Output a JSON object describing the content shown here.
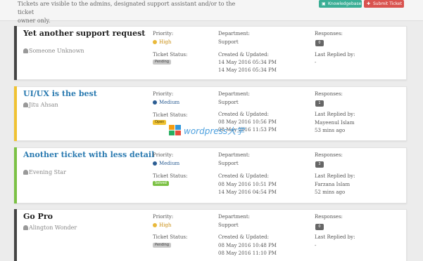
{
  "header": {
    "notice_line1": "Tickets are visible to the admins, designated support assistant and/or to the ticket",
    "notice_line2": "owner only.",
    "knowledgebase_label": "Knowledgebase",
    "submit_label": "Submit Ticket",
    "knowledgebase_icon": "book-icon",
    "submit_icon": "plus-icon"
  },
  "labels": {
    "priority": "Priority:",
    "ticket_status": "Ticket Status:",
    "department": "Department:",
    "created_updated": "Created & Updated:",
    "responses": "Responses:",
    "last_replied": "Last Replied by:"
  },
  "tickets": [
    {
      "title": "Yet another support request",
      "author": "Someone Unknown",
      "priority": "High",
      "status": "Pending",
      "department": "Support",
      "created": "14 May 2016 05:34 PM",
      "updated": "14 May 2016 05:34 PM",
      "responses": "0",
      "last_replied_by": "-",
      "last_replied_ago": ""
    },
    {
      "title": "UI/UX is the best",
      "author": "Jitu Ahsan",
      "priority": "Medium",
      "status": "Open",
      "department": "Support",
      "created": "08 May 2016 10:56 PM",
      "updated": "08 May 2016 11:53 PM",
      "responses": "1",
      "last_replied_by": "Mayeenul Islam",
      "last_replied_ago": "53 mins ago"
    },
    {
      "title": "Another ticket with less detail",
      "author": "Evening Star",
      "priority": "Medium",
      "status": "Solved",
      "department": "Support",
      "created": "08 May 2016 10:51 PM",
      "updated": "14 May 2016 04:54 PM",
      "responses": "3",
      "last_replied_by": "Farzana Islam",
      "last_replied_ago": "52 mins ago"
    },
    {
      "title": "Go Pro",
      "author": "Alington Wonder",
      "priority": "High",
      "status": "Pending",
      "department": "Support",
      "created": "08 May 2016 10:48 PM",
      "updated": "08 May 2016 11:10 PM",
      "responses": "0",
      "last_replied_by": "-",
      "last_replied_ago": ""
    }
  ],
  "watermark": {
    "text": "wordpress大学"
  }
}
